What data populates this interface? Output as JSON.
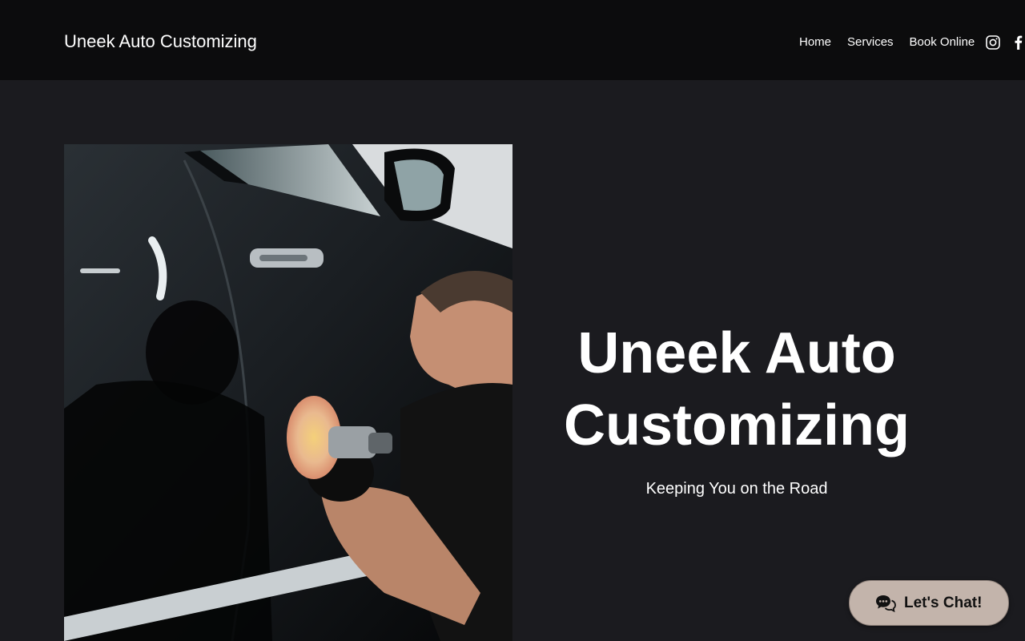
{
  "header": {
    "site_title": "Uneek Auto Customizing",
    "nav": [
      {
        "label": "Home"
      },
      {
        "label": "Services"
      },
      {
        "label": "Book Online"
      }
    ],
    "social": [
      {
        "icon": "instagram-icon"
      },
      {
        "icon": "facebook-icon"
      }
    ]
  },
  "hero": {
    "title": "Uneek Auto Customizing",
    "subtitle": "Keeping You on the Road",
    "image": {
      "subject": "photo-car-polishing"
    }
  },
  "chat": {
    "label": "Let's Chat!",
    "icon": "chat-bubble-icon"
  },
  "colors": {
    "page_bg": "#1b1b1f",
    "header_bg": "#0c0c0d",
    "chat_bg": "#c3b4ab",
    "text": "#ffffff"
  }
}
